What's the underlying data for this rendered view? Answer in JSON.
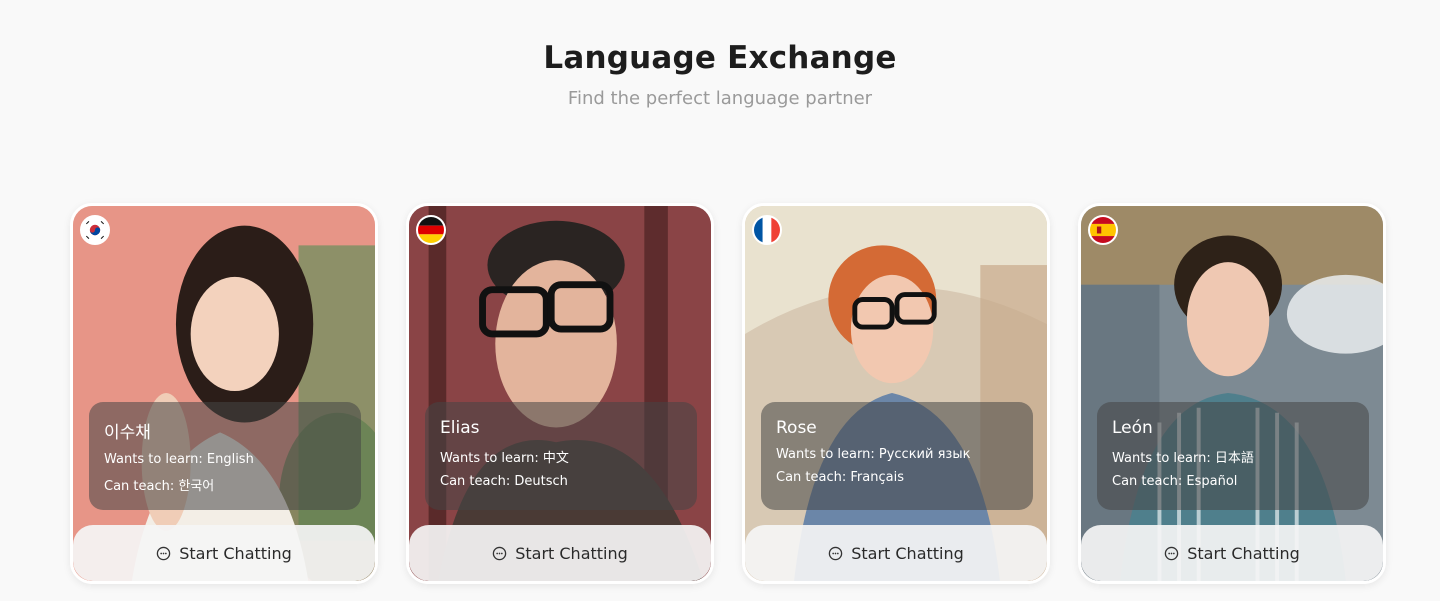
{
  "header": {
    "title": "Language Exchange",
    "subtitle": "Find the perfect language partner"
  },
  "cards": [
    {
      "name": "이수채",
      "learn_label": "Wants to learn:",
      "learn": "English",
      "teach_label": "Can teach:",
      "teach": "한국어",
      "flag": "south-korea",
      "button_label": "Start Chatting",
      "colors": {
        "bg": "#e9968a",
        "accent": "#6f8f5e"
      }
    },
    {
      "name": "Elias",
      "learn_label": "Wants to learn:",
      "learn": "中文",
      "teach_label": "Can teach:",
      "teach": "Deutsch",
      "flag": "germany",
      "button_label": "Start Chatting",
      "colors": {
        "bg": "#7a3b3c",
        "accent": "#4a3a35"
      }
    },
    {
      "name": "Rose",
      "learn_label": "Wants to learn:",
      "learn": "Русский язык",
      "teach_label": "Can teach:",
      "teach": "Français",
      "flag": "france",
      "button_label": "Start Chatting",
      "colors": {
        "bg": "#d8c9b4",
        "accent": "#6b86a8"
      }
    },
    {
      "name": "León",
      "learn_label": "Wants to learn:",
      "learn": "日本語",
      "teach_label": "Can teach:",
      "teach": "Español",
      "flag": "spain",
      "button_label": "Start Chatting",
      "colors": {
        "bg": "#7d8a93",
        "accent": "#4f7f8c"
      }
    }
  ]
}
